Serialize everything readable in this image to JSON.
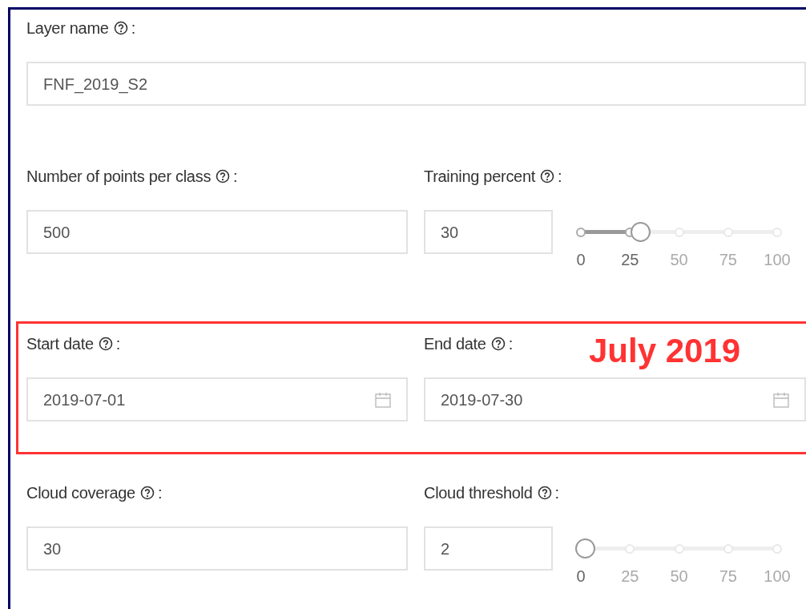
{
  "rows": [
    {
      "fields": [
        {
          "kind": "text",
          "label": "Layer name",
          "colon": ":",
          "value": "FNF_2019_S2"
        }
      ]
    },
    {
      "fields": [
        {
          "kind": "text",
          "label": "Number of points per class",
          "colon": ":",
          "value": "500"
        },
        {
          "kind": "slider",
          "label": "Training percent",
          "colon": ":",
          "value": "30",
          "level": 0.3,
          "marks": [
            "0",
            "25",
            "50",
            "75",
            "100"
          ]
        }
      ]
    },
    {
      "highlight": {
        "color": "#ff3333",
        "note": "July 2019"
      },
      "fields": [
        {
          "kind": "date",
          "label": "Start date",
          "colon": ":",
          "value": "2019-07-01"
        },
        {
          "kind": "date",
          "label": "End date",
          "colon": ":",
          "value": "2019-07-30"
        }
      ]
    },
    {
      "fields": [
        {
          "kind": "text",
          "label": "Cloud coverage",
          "colon": ":",
          "value": "30"
        },
        {
          "kind": "slider",
          "label": "Cloud threshold",
          "colon": ":",
          "value": "2",
          "level": 0.02,
          "marks": [
            "0",
            "25",
            "50",
            "75",
            "100"
          ]
        }
      ]
    }
  ]
}
